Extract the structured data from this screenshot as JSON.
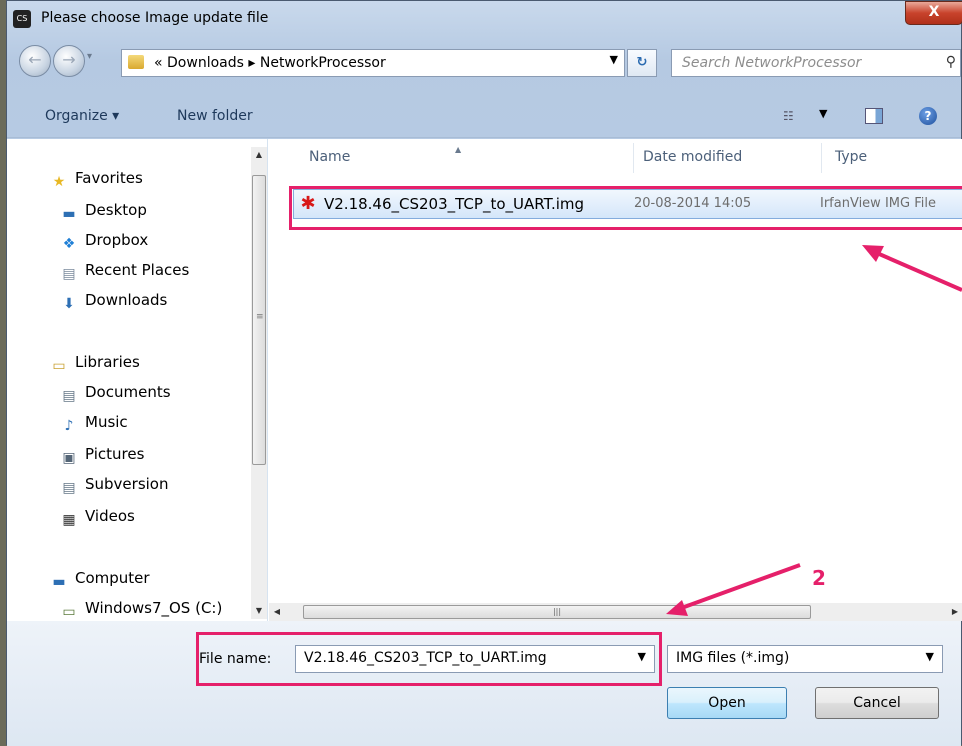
{
  "window": {
    "title": "Please choose Image update file",
    "app_icon_text": "CS",
    "close_label": "X"
  },
  "navbar": {
    "back_glyph": "←",
    "forward_glyph": "→",
    "address_prefix": "«",
    "address_parts": [
      "Downloads",
      "NetworkProcessor"
    ],
    "address_separator": "▸",
    "search_placeholder": "Search NetworkProcessor"
  },
  "toolbar": {
    "organize_label": "Organize ▾",
    "new_folder_label": "New folder"
  },
  "sidebar": {
    "sections": [
      {
        "label": "Favorites",
        "icon": "star-icon",
        "glyph": "★",
        "color": "#e8b824"
      },
      {
        "label": "Desktop",
        "icon": "desktop-icon",
        "glyph": "▬",
        "color": "#2d6fb4"
      },
      {
        "label": "Dropbox",
        "icon": "dropbox-icon",
        "glyph": "❖",
        "color": "#1f7fd6"
      },
      {
        "label": "Recent Places",
        "icon": "recent-places-icon",
        "glyph": "▤",
        "color": "#7a8a9c"
      },
      {
        "label": "Downloads",
        "icon": "downloads-icon",
        "glyph": "⬇",
        "color": "#2d6fb4"
      },
      {
        "label": "Libraries",
        "icon": "libraries-icon",
        "glyph": "▭",
        "color": "#c8a030"
      },
      {
        "label": "Documents",
        "icon": "documents-icon",
        "glyph": "▤",
        "color": "#667788"
      },
      {
        "label": "Music",
        "icon": "music-icon",
        "glyph": "♪",
        "color": "#2d6fb4"
      },
      {
        "label": "Pictures",
        "icon": "pictures-icon",
        "glyph": "▣",
        "color": "#556677"
      },
      {
        "label": "Subversion",
        "icon": "subversion-icon",
        "glyph": "▤",
        "color": "#667788"
      },
      {
        "label": "Videos",
        "icon": "videos-icon",
        "glyph": "▦",
        "color": "#333333"
      },
      {
        "label": "Computer",
        "icon": "computer-icon",
        "glyph": "▬",
        "color": "#2d6fb4"
      },
      {
        "label": "Windows7_OS (C:)",
        "icon": "drive-icon",
        "glyph": "▭",
        "color": "#5a7a3a"
      }
    ]
  },
  "file_list": {
    "columns": [
      "Name",
      "Date modified",
      "Type"
    ],
    "rows": [
      {
        "name": "V2.18.46_CS203_TCP_to_UART.img",
        "date": "20-08-2014 14:05",
        "type": "IrfanView IMG File"
      }
    ]
  },
  "scrollbar_grip": "|||",
  "bottom": {
    "file_name_label": "File name:",
    "file_name_value": "V2.18.46_CS203_TCP_to_UART.img",
    "file_type_value": "IMG files (*.img)",
    "open_label": "Open",
    "cancel_label": "Cancel"
  },
  "annotations": {
    "marker_2": "2",
    "color": "#e5206a"
  }
}
